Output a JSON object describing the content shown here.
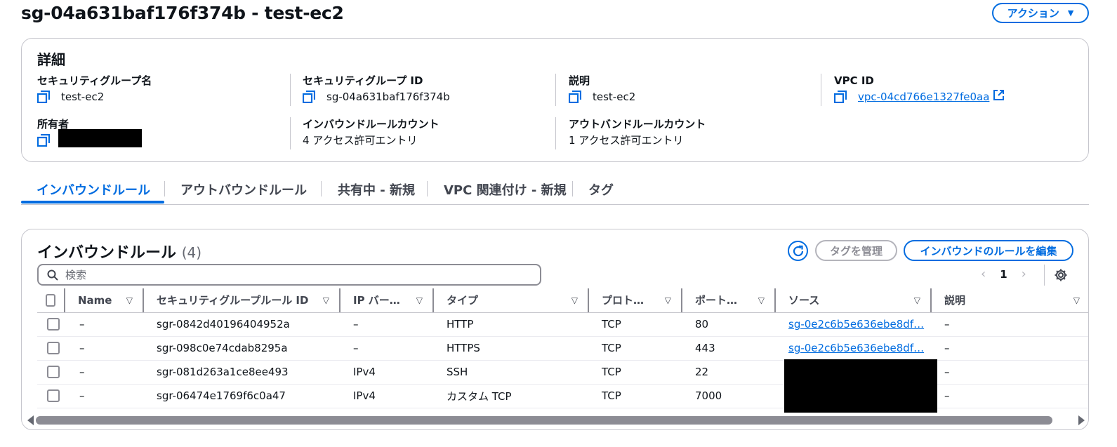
{
  "header": {
    "title": "sg-04a631baf176f374b - test-ec2",
    "action_label": "アクション",
    "action_caret": "▼"
  },
  "details": {
    "title": "詳細",
    "fields": [
      {
        "label": "セキュリティグループ名",
        "value": "test-ec2"
      },
      {
        "label": "セキュリティグループ ID",
        "value": "sg-04a631baf176f374b"
      },
      {
        "label": "説明",
        "value": "test-ec2"
      },
      {
        "label": "VPC ID",
        "value": "vpc-04cd766e1327fe0aa"
      },
      {
        "label": "所有者",
        "value": ""
      },
      {
        "label": "インバウンドルールカウント",
        "value": "4 アクセス許可エントリ"
      },
      {
        "label": "アウトバンドルールカウント",
        "value": "1 アクセス許可エントリ"
      }
    ]
  },
  "tabs": [
    {
      "label": "インバウンドルール",
      "active": true
    },
    {
      "label": "アウトバウンドルール",
      "active": false
    },
    {
      "label": "共有中 - 新規",
      "active": false
    },
    {
      "label": "VPC 関連付け - 新規",
      "active": false
    },
    {
      "label": "タグ",
      "active": false
    }
  ],
  "rules": {
    "title": "インバウンドルール",
    "count": "(4)",
    "manage_tags_label": "タグを管理",
    "edit_label": "インバウンドのルールを編集",
    "search_placeholder": "検索",
    "page": "1",
    "columns": [
      "Name",
      "セキュリティグループルール ID",
      "IP バー…",
      "タイプ",
      "プロト…",
      "ポート…",
      "ソース",
      "説明"
    ],
    "rows": [
      {
        "name": "–",
        "id": "sgr-0842d40196404952a",
        "ip": "–",
        "type": "HTTP",
        "protocol": "TCP",
        "port": "80",
        "source": "sg-0e2c6b5e636ebe8df…",
        "desc": "–"
      },
      {
        "name": "–",
        "id": "sgr-098c0e74cdab8295a",
        "ip": "–",
        "type": "HTTPS",
        "protocol": "TCP",
        "port": "443",
        "source": "sg-0e2c6b5e636ebe8df…",
        "desc": "–"
      },
      {
        "name": "–",
        "id": "sgr-081d263a1ce8ee493",
        "ip": "IPv4",
        "type": "SSH",
        "protocol": "TCP",
        "port": "22",
        "source": "",
        "desc": "–"
      },
      {
        "name": "–",
        "id": "sgr-06474e1769f6c0a47",
        "ip": "IPv4",
        "type": "カスタム TCP",
        "protocol": "TCP",
        "port": "7000",
        "source": "",
        "desc": "–"
      }
    ]
  },
  "colors": {
    "accent": "#006ce0",
    "text": "#0f141a",
    "border": "#c6c6cd"
  }
}
